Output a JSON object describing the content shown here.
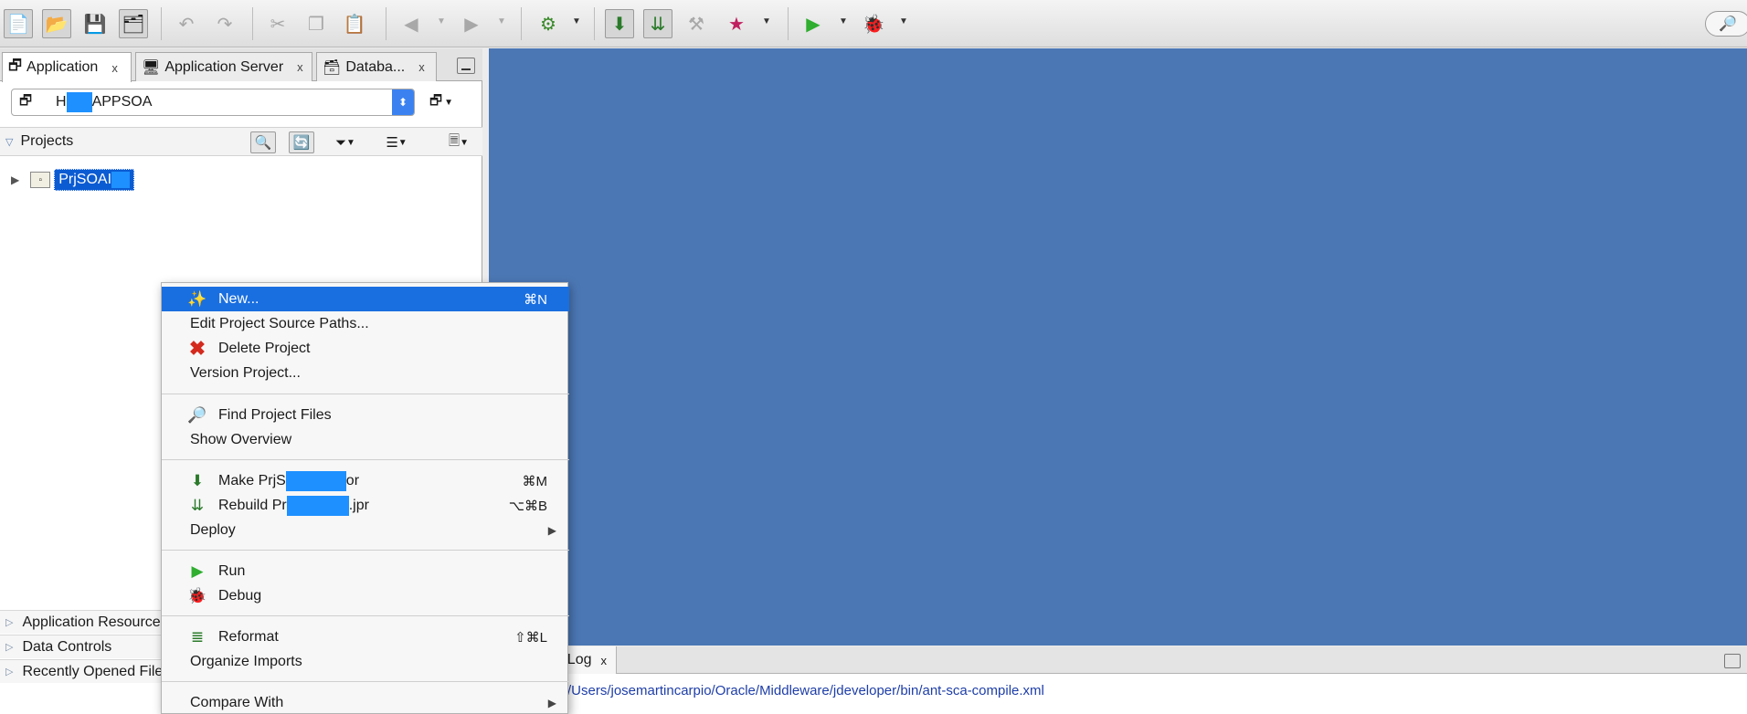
{
  "toolbar": {
    "icons": [
      "new-file-icon",
      "open-folder-icon",
      "save-icon",
      "save-all-icon",
      "undo-icon",
      "redo-icon",
      "cut-icon",
      "copy-icon",
      "paste-icon",
      "back-icon",
      "forward-icon",
      "sdl-icon",
      "make-icon",
      "rebuild-icon",
      "clean-icon",
      "swoosh-icon",
      "run-icon",
      "debug-icon",
      "binoculars-icon"
    ]
  },
  "tabs": [
    {
      "label": "Application",
      "close": "x"
    },
    {
      "label": "Application Server",
      "close": "x"
    },
    {
      "label": "Databa...",
      "close": "x"
    }
  ],
  "app_select": {
    "prefix": "H",
    "suffix": "APPSOA"
  },
  "projects": {
    "label": "Projects"
  },
  "tree": {
    "project_name": "PrjSOAI"
  },
  "accordion": [
    {
      "label": "Application Resources"
    },
    {
      "label": "Data Controls"
    },
    {
      "label": "Recently Opened Files"
    }
  ],
  "log": {
    "tab_label": "Log",
    "close": "x",
    "line": "/Users/josemartincarpio/Oracle/Middleware/jdeveloper/bin/ant-sca-compile.xml"
  },
  "context_menu": {
    "new": {
      "label": "New...",
      "shortcut": "⌘N"
    },
    "edit_source_paths": {
      "label": "Edit Project Source Paths..."
    },
    "delete_project": {
      "label": "Delete Project"
    },
    "version_project": {
      "label": "Version Project..."
    },
    "find_files": {
      "label": "Find Project Files"
    },
    "show_overview": {
      "label": "Show Overview"
    },
    "make": {
      "prefix": "Make PrjS",
      "suffix": "or",
      "shortcut": "⌘M"
    },
    "rebuild": {
      "prefix": "Rebuild Pr",
      "suffix": ".jpr",
      "shortcut": "⌥⌘B"
    },
    "deploy": {
      "label": "Deploy"
    },
    "run": {
      "label": "Run"
    },
    "debug": {
      "label": "Debug"
    },
    "reformat": {
      "label": "Reformat",
      "shortcut": "⇧⌘L"
    },
    "organize_imports": {
      "label": "Organize Imports"
    },
    "compare_with": {
      "label": "Compare With"
    }
  },
  "colors": {
    "editor_bg": "#4b77b4",
    "selection": "#1a6fe0",
    "redaction": "#1e90ff"
  }
}
